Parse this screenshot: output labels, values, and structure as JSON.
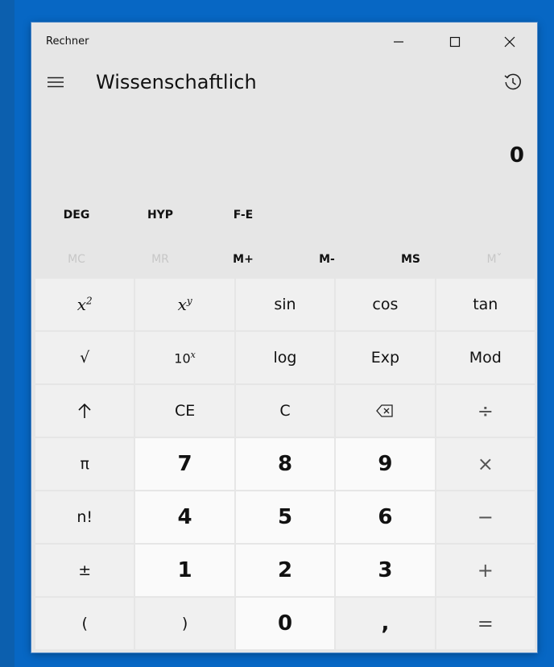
{
  "window": {
    "title": "Rechner",
    "controls": {
      "minimize": "—",
      "maximize": "☐",
      "close": "✕"
    }
  },
  "header": {
    "mode_title": "Wissenschaftlich",
    "menu_icon": "hamburger-menu-icon",
    "history_icon": "history-icon"
  },
  "display": {
    "value": "0"
  },
  "mode_buttons": [
    "DEG",
    "HYP",
    "F-E"
  ],
  "memory_buttons": [
    {
      "label": "MC",
      "enabled": false
    },
    {
      "label": "MR",
      "enabled": false
    },
    {
      "label": "M+",
      "enabled": true
    },
    {
      "label": "M-",
      "enabled": true
    },
    {
      "label": "MS",
      "enabled": true
    },
    {
      "label": "Mˇ",
      "enabled": false
    }
  ],
  "keys": {
    "square": {
      "base": "x",
      "exp": "2"
    },
    "power": {
      "base": "x",
      "exp": "y"
    },
    "sin": "sin",
    "cos": "cos",
    "tan": "tan",
    "sqrt": "√",
    "ten_pow": {
      "base": "10",
      "exp": "x"
    },
    "log": "log",
    "exp": "Exp",
    "mod": "Mod",
    "shift": "↑",
    "ce": "CE",
    "c": "C",
    "backspace": "⌫",
    "divide": "÷",
    "pi": "π",
    "seven": "7",
    "eight": "8",
    "nine": "9",
    "multiply": "×",
    "factorial": "n!",
    "four": "4",
    "five": "5",
    "six": "6",
    "minus": "−",
    "negate": "±",
    "one": "1",
    "two": "2",
    "three": "3",
    "plus": "+",
    "open_paren": "(",
    "close_paren": ")",
    "zero": "0",
    "decimal": ",",
    "equals": "="
  }
}
